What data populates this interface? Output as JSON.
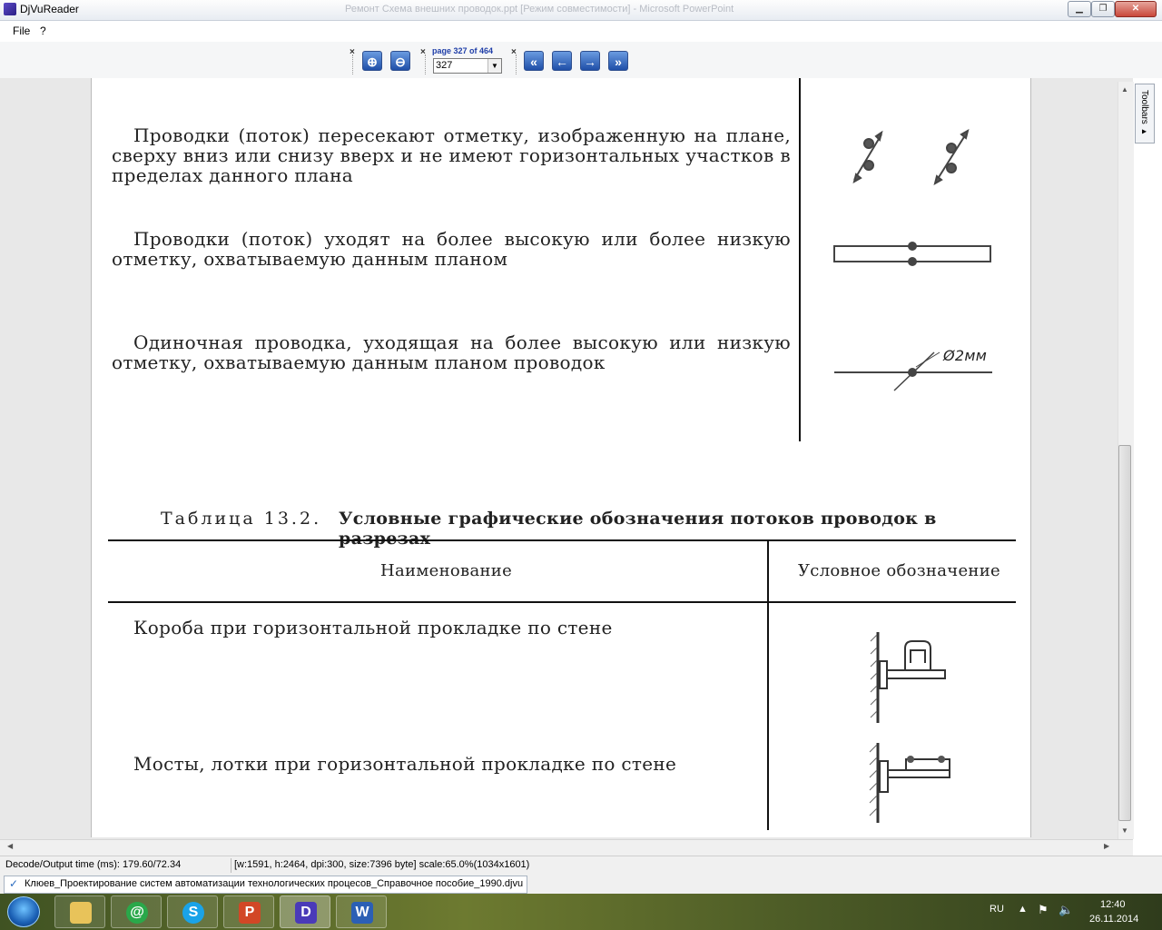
{
  "window": {
    "title": "DjVuReader",
    "background_title": "Ремонт Схема внешних проводок.ppt [Режим совместимости] - Microsoft PowerPoint",
    "minimize_icon": "minimize-icon",
    "maximize_icon": "maximize-icon",
    "close_glyph": "✕"
  },
  "menu": {
    "file": "File",
    "help": "?"
  },
  "toolbar": {
    "close_glyph": "×",
    "zoom_in": "⊕",
    "zoom_out": "⊖",
    "page_label": "page 327 of 464",
    "page_value": "327",
    "first": "«",
    "prev": "←",
    "next": "→",
    "last": "»"
  },
  "side_panel": {
    "label": "Toolbars ▸"
  },
  "document": {
    "row1": "Проводки (поток) пересекают отметку, изображенную на плане, сверху вниз или снизу вверх и не имеют горизонтальных участков в пределах данного плана",
    "row2": "Проводки (поток) уходят на более высокую или более низкую отметку, охватываемую данным планом",
    "row3": "Одиночная проводка, уходящая на более высокую или низкую отметку, охватываемую данным планом проводок",
    "row3_symbol_label": "Ø2мм",
    "table_caption_prefix": "Таблица 13.2.",
    "table_caption": "Условные графические обозначения потоков проводок в разрезах",
    "col_name": "Наименование",
    "col_symbol": "Условное обозначение",
    "t_row1": "Короба при горизонтальной прокладке по стене",
    "t_row2": "Мосты, лотки при горизонтальной прокладке по стене"
  },
  "status": {
    "decode": "Decode/Output time (ms): 179.60/72.34",
    "info": "[w:1591, h:2464, dpi:300, size:7396 byte] scale:65.0%(1034x1601)"
  },
  "file": {
    "name": "Клюев_Проектирование систем автоматизации технологических процесов_Справочное пособие_1990.djvu"
  },
  "taskbar": {
    "apps": [
      "explorer",
      "mail-agent",
      "skype",
      "powerpoint",
      "djvureader",
      "word"
    ],
    "lang": "RU",
    "time": "12:40",
    "date": "26.11.2014"
  },
  "colors": {
    "accent": "#1f4fa8",
    "taskbar": "#5a6a2a"
  }
}
